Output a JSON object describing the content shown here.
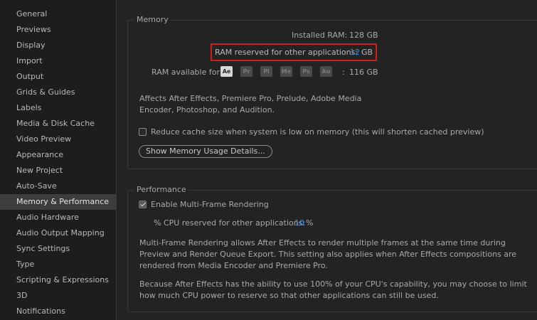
{
  "sidebar": {
    "items": [
      {
        "label": "General"
      },
      {
        "label": "Previews"
      },
      {
        "label": "Display"
      },
      {
        "label": "Import"
      },
      {
        "label": "Output"
      },
      {
        "label": "Grids & Guides"
      },
      {
        "label": "Labels"
      },
      {
        "label": "Media & Disk Cache"
      },
      {
        "label": "Video Preview"
      },
      {
        "label": "Appearance"
      },
      {
        "label": "New Project"
      },
      {
        "label": "Auto-Save"
      },
      {
        "label": "Memory & Performance"
      },
      {
        "label": "Audio Hardware"
      },
      {
        "label": "Audio Output Mapping"
      },
      {
        "label": "Sync Settings"
      },
      {
        "label": "Type"
      },
      {
        "label": "Scripting & Expressions"
      },
      {
        "label": "3D"
      },
      {
        "label": "Notifications"
      }
    ],
    "selected": "Memory & Performance"
  },
  "memory": {
    "title": "Memory",
    "installed_label": "Installed RAM:",
    "installed_value": "128 GB",
    "reserved_label": "RAM reserved for other applications:",
    "reserved_value": "12",
    "reserved_unit": "GB",
    "available_label": "RAM available for",
    "apps": [
      {
        "abbr": "Ae"
      },
      {
        "abbr": "Pr"
      },
      {
        "abbr": "Pl"
      },
      {
        "abbr": "Me"
      },
      {
        "abbr": "Ps"
      },
      {
        "abbr": "Au"
      }
    ],
    "available_sep": ":",
    "available_value": "116 GB",
    "affects_text": "Affects After Effects, Premiere Pro, Prelude, Adobe Media Encoder, Photoshop, and Audition.",
    "reduce_cache_label": "Reduce cache size when system is low on memory (this will shorten cached preview)",
    "reduce_cache_checked": false,
    "details_button": "Show Memory Usage Details..."
  },
  "performance": {
    "title": "Performance",
    "mfr_label": "Enable Multi-Frame Rendering",
    "mfr_checked": true,
    "cpu_label": "% CPU reserved for other applications:",
    "cpu_value": "10",
    "cpu_unit": "%",
    "desc1": "Multi-Frame Rendering allows After Effects to render multiple frames at the same time during Preview and Render Queue Export. This setting also applies when After Effects compositions are rendered from Media Encoder and Premiere Pro.",
    "desc2": "Because After Effects has the ability to use 100% of your CPU's capability, you may choose to limit how much CPU power to reserve so that other applications can still be used."
  },
  "colors": {
    "accent_value": "#3d8fe0",
    "highlight_box": "#d21d1d"
  }
}
